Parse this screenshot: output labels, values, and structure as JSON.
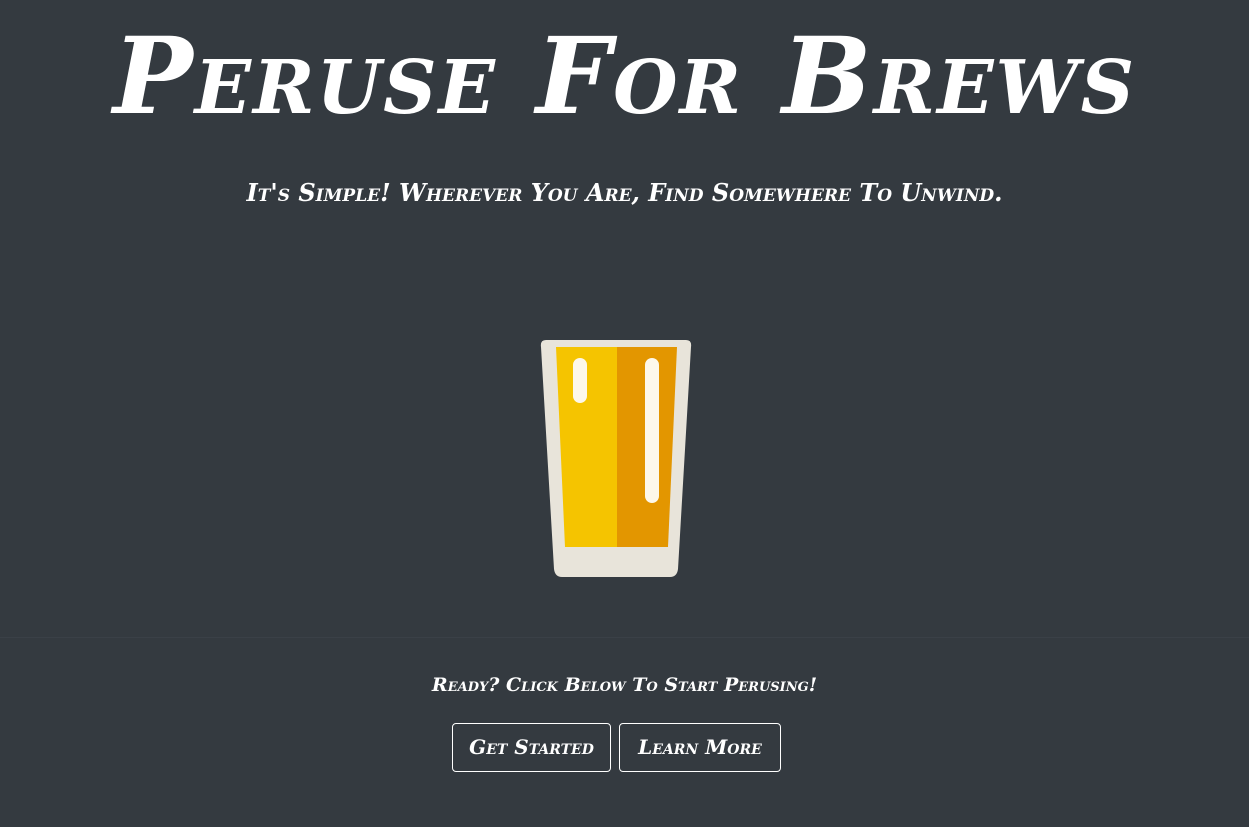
{
  "hero": {
    "title": "Peruse For Brews",
    "subtitle": "It's Simple! Wherever You Are, Find Somewhere To Unwind."
  },
  "icon": "beer-glass-icon",
  "colors": {
    "background": "#343a40",
    "text": "#ffffff",
    "glass_rim": "#e8e4da",
    "beer_light": "#f5c400",
    "beer_dark": "#e39600",
    "highlight": "#fdf8ea"
  },
  "footer": {
    "cta_text": "Ready? Click Below To Start Perusing!",
    "buttons": {
      "get_started": "Get Started",
      "learn_more": "Learn More"
    }
  }
}
